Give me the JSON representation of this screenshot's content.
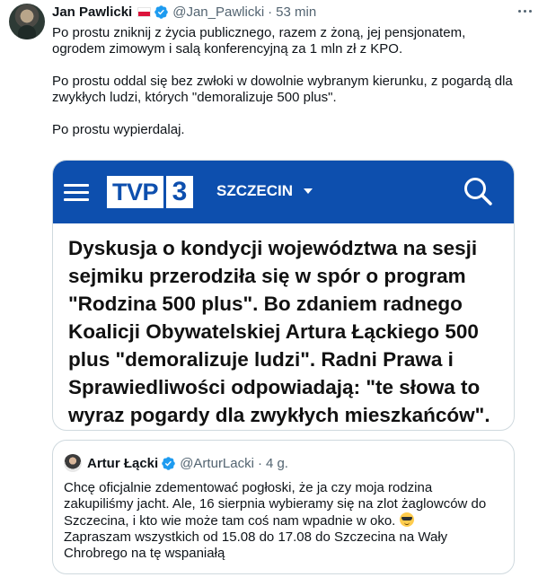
{
  "tweet": {
    "author_name": "Jan Pawlicki",
    "author_handle": "@Jan_Pawlicki",
    "separator": "·",
    "timestamp": "53 min",
    "paragraphs": [
      "Po prostu zniknij z życia publicznego, razem z żoną, jej pensjonatem, ogrodem zimowym i salą konferencyjną za 1 mln zł z KPO.",
      "Po prostu oddal się bez zwłoki w dowolnie wybranym kierunku, z pogardą dla zwykłych ludzi, których \"demoralizuje 500 plus\".",
      "Po prostu wypierdalaj."
    ],
    "flag_icon": "poland-flag-icon",
    "verified_icon": "verified-badge-icon",
    "verified_color": "#1d9bf0",
    "more_icon": "more-options-icon"
  },
  "media": {
    "brand_box": "TVP",
    "brand_number": "3",
    "region": "SZCZECIN",
    "brand_color": "#0d4fae",
    "menu_icon": "hamburger-menu-icon",
    "search_icon": "search-icon",
    "article_text": "Dyskusja o kondycji województwa na sesji sejmiku przerodziła się w spór o program \"Rodzina 500 plus\". Bo zdaniem radnego Koalicji Obywatelskiej Artura Łąckiego 500 plus \"demoralizuje ludzi\". Radni Prawa i Sprawiedliwości odpowiadają: \"te słowa to wyraz pogardy dla zwykłych mieszkańców\"."
  },
  "quoted_tweet": {
    "author_name": "Artur Łącki",
    "author_handle": "@ArturLacki",
    "separator": "·",
    "timestamp": "4 g.",
    "text_before_emoji": "Chcę oficjalnie zdementować pogłoski, że ja czy moja rodzina zakupiliśmy jacht. Ale,  16 sierpnia wybieramy się na zlot żaglowców do Szczecina, i kto wie może tam  coś nam wpadnie w oko. ",
    "emoji": "sunglasses-emoji",
    "text_after_emoji": "Zapraszam wszystkich od 15.08 do 17.08 do Szczecina na Wały Chrobrego na tę wspaniałą"
  }
}
